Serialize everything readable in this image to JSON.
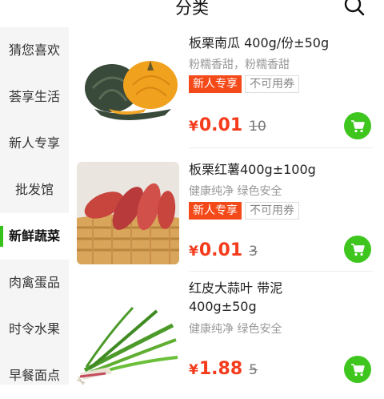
{
  "header": {
    "title": "分类"
  },
  "sidebar": {
    "items": [
      {
        "label": "猜您喜欢"
      },
      {
        "label": "荟享生活"
      },
      {
        "label": "新人专享"
      },
      {
        "label": "批发馆"
      },
      {
        "label": "新鲜蔬菜"
      },
      {
        "label": "肉禽蛋品"
      },
      {
        "label": "时令水果"
      },
      {
        "label": "早餐面点"
      }
    ],
    "active": "新鲜蔬菜"
  },
  "products": [
    {
      "name": "板栗南瓜 400g/份±50g",
      "desc": "粉糯香甜，粉糯香甜",
      "tag_new": "新人专享",
      "tag_coupon": "不可用券",
      "currency": "¥",
      "price": "0.01",
      "original_price": "10",
      "image": "pumpkin"
    },
    {
      "name": "板栗红薯400g±100g",
      "desc": "健康纯净 绿色安全",
      "tag_new": "新人专享",
      "tag_coupon": "不可用券",
      "currency": "¥",
      "price": "0.01",
      "original_price": "3",
      "image": "sweet-potato"
    },
    {
      "name_line1": "红皮大蒜叶 带泥",
      "name_line2": "400g±50g",
      "desc": "健康纯净 绿色安全",
      "currency": "¥",
      "price": "1.88",
      "original_price": "5",
      "image": "garlic-leaves"
    }
  ],
  "colors": {
    "accent_green": "#3ec61e",
    "price_red": "#f43b1b",
    "tag_red": "#f44a1a"
  }
}
